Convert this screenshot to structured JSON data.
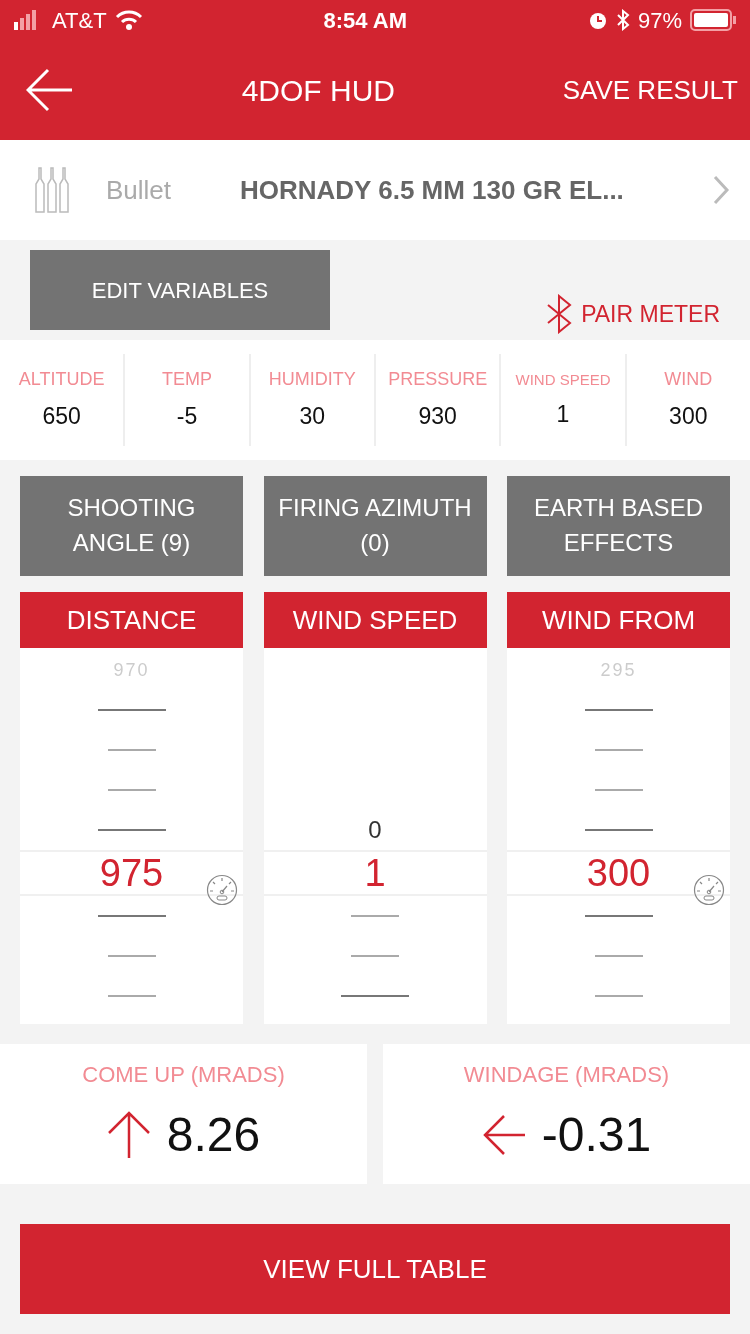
{
  "status_bar": {
    "carrier": "AT&T",
    "time": "8:54 AM",
    "battery": "97%"
  },
  "header": {
    "title": "4DOF HUD",
    "action": "SAVE RESULT"
  },
  "bullet": {
    "label": "Bullet",
    "value": "HORNADY 6.5 MM 130 GR EL..."
  },
  "edit_button": "EDIT VARIABLES",
  "pair_meter": "PAIR METER",
  "conditions": [
    {
      "label": "ALTITUDE",
      "value": "650"
    },
    {
      "label": "TEMP",
      "value": "-5"
    },
    {
      "label": "HUMIDITY",
      "value": "30"
    },
    {
      "label": "PRESSURE",
      "value": "930"
    },
    {
      "label": "WIND SPEED",
      "value": "1",
      "small": true
    },
    {
      "label": "WIND",
      "value": "300"
    }
  ],
  "option_buttons": [
    "SHOOTING ANGLE (9)",
    "FIRING AZIMUTH (0)",
    "EARTH BASED EFFECTS"
  ],
  "pickers": [
    {
      "title": "DISTANCE",
      "selected_value": "975",
      "meter": true,
      "above": [
        {
          "kind": "faded",
          "text": "970"
        },
        {
          "kind": "major"
        },
        {
          "kind": "minor"
        },
        {
          "kind": "minor"
        },
        {
          "kind": "major"
        }
      ],
      "below": [
        {
          "kind": "major"
        },
        {
          "kind": "minor"
        },
        {
          "kind": "minor"
        }
      ]
    },
    {
      "title": "WIND SPEED",
      "selected_value": "1",
      "meter": false,
      "above": [
        {
          "kind": "blank"
        },
        {
          "kind": "blank"
        },
        {
          "kind": "blank"
        },
        {
          "kind": "blank"
        },
        {
          "kind": "label",
          "text": "0"
        }
      ],
      "below": [
        {
          "kind": "minor"
        },
        {
          "kind": "minor"
        },
        {
          "kind": "major"
        }
      ]
    },
    {
      "title": "WIND FROM",
      "selected_value": "300",
      "meter": true,
      "above": [
        {
          "kind": "faded",
          "text": "295"
        },
        {
          "kind": "major"
        },
        {
          "kind": "minor"
        },
        {
          "kind": "minor"
        },
        {
          "kind": "major"
        }
      ],
      "below": [
        {
          "kind": "major"
        },
        {
          "kind": "minor"
        },
        {
          "kind": "minor"
        }
      ]
    }
  ],
  "results": [
    {
      "label": "COME UP (MRADS)",
      "value": "8.26",
      "kind": "up"
    },
    {
      "label": "WINDAGE (MRADS)",
      "value": "-0.31",
      "kind": "left"
    }
  ],
  "footer_button": "VIEW FULL TABLE"
}
